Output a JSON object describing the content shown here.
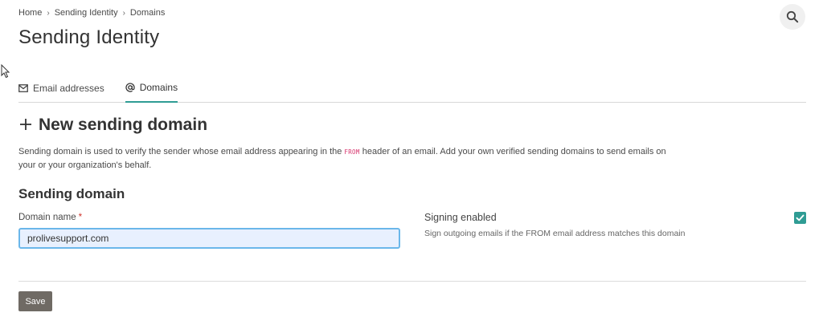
{
  "breadcrumb": {
    "items": [
      "Home",
      "Sending Identity",
      "Domains"
    ],
    "separator": "›"
  },
  "page": {
    "title": "Sending Identity"
  },
  "search": {
    "icon": "search-icon"
  },
  "tabs": [
    {
      "label": "Email addresses",
      "icon": "envelope-icon",
      "active": false
    },
    {
      "label": "Domains",
      "icon": "at-sign-icon",
      "active": true
    }
  ],
  "form": {
    "heading": "New sending domain",
    "heading_icon": "plus-icon",
    "description_before": "Sending domain is used to verify the sender whose email address appearing in the ",
    "description_code": "FROM",
    "description_after": " header of an email. Add your own verified sending domains to send emails on your or your organization's behalf.",
    "section_title": "Sending domain",
    "domain_label": "Domain name",
    "required_mark": "*",
    "domain_value": "prolivesupport.com",
    "signing_label": "Signing enabled",
    "signing_help": "Sign outgoing emails if the FROM email address matches this domain",
    "signing_checked": true,
    "save_label": "Save"
  },
  "colors": {
    "accent": "#2f9c94",
    "save_button": "#6f6a64",
    "required": "#d0342c",
    "code": "#d6336c",
    "input_focus_border": "#6bb7ea",
    "input_background": "#e8f0fe"
  }
}
